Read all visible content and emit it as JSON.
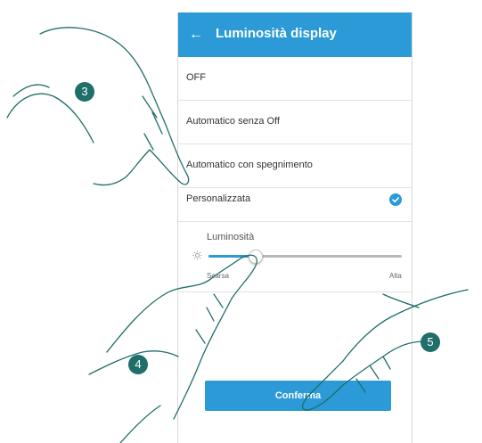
{
  "header": {
    "title": "Luminosità display",
    "back_icon": "arrow-left-icon",
    "color": "#2b9ad6"
  },
  "options": [
    {
      "label": "OFF",
      "selected": false
    },
    {
      "label": "Automatico senza Off",
      "selected": false
    },
    {
      "label": "Automatico con spegnimento",
      "selected": false
    },
    {
      "label": "Personalizzata",
      "selected": true
    }
  ],
  "brightness": {
    "title": "Luminosità",
    "min_label": "Scarsa",
    "max_label": "Alta",
    "level": 0.24,
    "icon": "sun-icon"
  },
  "confirm_label": "Conferma",
  "steps": [
    "3",
    "4",
    "5"
  ],
  "colors": {
    "accent": "#2b9ad6",
    "badge": "#1f6e69"
  }
}
